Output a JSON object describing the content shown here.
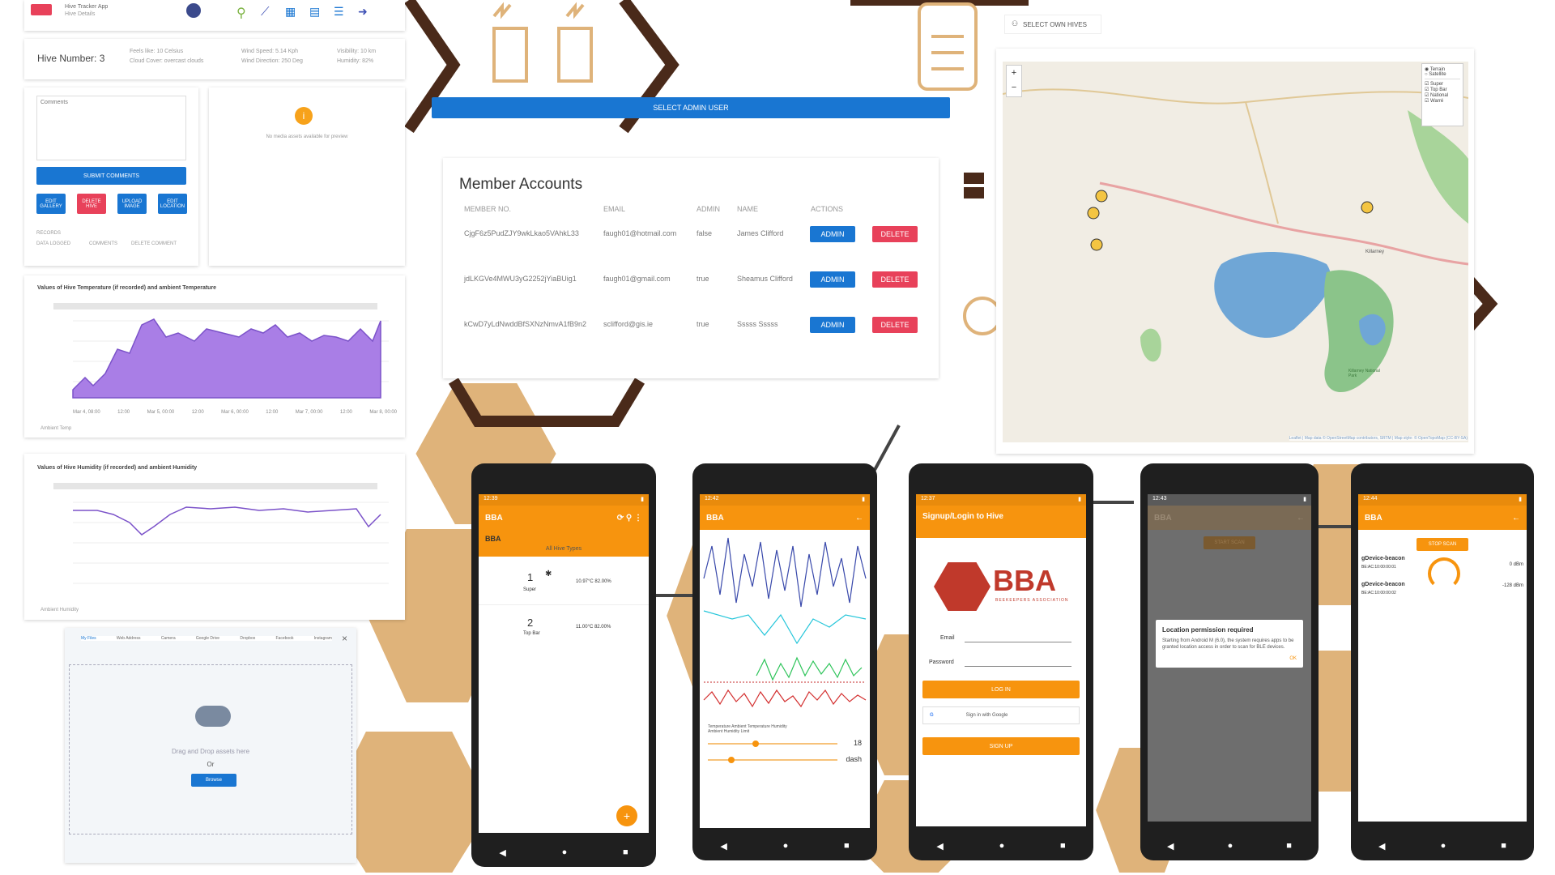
{
  "colors": {
    "orange": "#f7940e",
    "blue": "#1976d2",
    "red": "#e8415a",
    "purple": "#a97ee6",
    "honey": "#dfb37a",
    "hexline": "#4a2a1a"
  },
  "hive_details": {
    "app_name": "Hive Tracker App",
    "page": "Hive Details",
    "hive_number": "Hive Number: 3",
    "weather_left": [
      "Feels like: 10 Celsius",
      "Cloud Cover: overcast clouds"
    ],
    "weather_mid": [
      "Wind Speed: 5.14 Kph",
      "Wind Direction: 250 Deg"
    ],
    "weather_right": [
      "Visibility: 10 km",
      "Humidity: 82%"
    ],
    "comments_placeholder": "Comments",
    "submit_label": "SUBMIT COMMENTS",
    "action_buttons": [
      "EDIT GALLERY",
      "DELETE HIVE",
      "UPLOAD IMAGE",
      "EDIT LOCATION"
    ],
    "records_label": "RECORDS",
    "record_tabs": [
      "DATA LOGGED",
      "COMMENTS",
      "DELETE COMMENT"
    ],
    "no_media": "No media assets available for preview"
  },
  "temp_chart_title": "Values of Hive Temperature (if recorded) and ambient Temperature",
  "temp_legend": "Ambient Temp",
  "temp_x_ticks": [
    "Mar 4, 08:00",
    "12:00",
    "Mar 5, 00:00",
    "12:00",
    "Mar 6, 00:00",
    "12:00",
    "Mar 7, 00:00",
    "12:00",
    "Mar 8, 00:00"
  ],
  "hum_chart_title": "Values of Hive Humidity (if recorded) and ambient Humidity",
  "hum_legend": "Ambient Humidity",
  "upload": {
    "tabs": [
      "My Files",
      "Web Address",
      "Camera",
      "Google Drive",
      "Dropbox",
      "Facebook",
      "Instagram"
    ],
    "drag_text": "Drag and Drop assets here",
    "or": "Or",
    "browse": "Browse"
  },
  "admin": {
    "select_admin": "SELECT ADMIN USER",
    "title": "Member Accounts",
    "headers": [
      "MEMBER NO.",
      "EMAIL",
      "ADMIN",
      "NAME",
      "ACTIONS"
    ],
    "rows": [
      {
        "id": "CjgF6z5PudZJY9wkLkao5VAhkL33",
        "email": "faugh01@hotmail.com",
        "admin": "false",
        "name": "James Clifford"
      },
      {
        "id": "jdLKGVe4MWU3yG2252jYiaBUig1",
        "email": "faugh01@gmail.com",
        "admin": "true",
        "name": "Sheamus Clifford"
      },
      {
        "id": "kCwD7yLdNwddBfSXNzNmvA1fB9n2",
        "email": "sclifford@gis.ie",
        "admin": "true",
        "name": "Sssss Sssss"
      }
    ],
    "admin_btn": "ADMIN",
    "delete_btn": "DELETE"
  },
  "map": {
    "select_own": "SELECT OWN HIVES",
    "zoom_in": "+",
    "zoom_out": "−",
    "layers": [
      "Terrain",
      "Satellite"
    ],
    "overlays": [
      "Super",
      "Top Bar",
      "National",
      "Warré"
    ],
    "town": "Killarney",
    "park": "Killarney National Park",
    "attribution": "Leaflet | Map data © OpenStreetMap contributors, SRTM | Map style: © OpenTopoMap (CC-BY-SA)"
  },
  "phone1": {
    "time": "12:39",
    "title": "BBA",
    "sub": "BBA",
    "filter": "All Hive Types",
    "items": [
      {
        "num": "1",
        "type": "Super",
        "reading": "10.97°C 82.00%"
      },
      {
        "num": "2",
        "type": "Top Bar",
        "reading": "11.00°C 82.00%"
      }
    ],
    "fab": "+"
  },
  "phone2": {
    "time": "12:42",
    "title": "BBA",
    "legend1": "Temperature  Ambient Temperature  Humidity",
    "legend2": "Ambient Humidity  Limit",
    "val1": "18",
    "val2": "dash"
  },
  "phone3": {
    "time": "12:37",
    "title": "Signup/Login to Hive",
    "logo": "BBA",
    "logo_sub": "BEEKEEPERS ASSOCIATION",
    "email": "Email",
    "password": "Password",
    "login": "LOG IN",
    "google": "Sign in with Google",
    "signup": "SIGN UP"
  },
  "phone4": {
    "time": "12:43",
    "title": "BBA",
    "start": "START SCAN",
    "dialog_title": "Location permission required",
    "dialog_body": "Starting from Android M (6.0), the system requires apps to be granted location access in order to scan for BLE devices.",
    "ok": "OK"
  },
  "phone5": {
    "time": "12:44",
    "title": "BBA",
    "stop": "STOP SCAN",
    "beacons": [
      {
        "name": "gDevice-beacon",
        "mac": "BE:AC:10:00:00:01",
        "rssi": "0 dBm"
      },
      {
        "name": "gDevice-beacon",
        "mac": "BE:AC:10:00:00:02",
        "rssi": "-128 dBm"
      }
    ]
  }
}
